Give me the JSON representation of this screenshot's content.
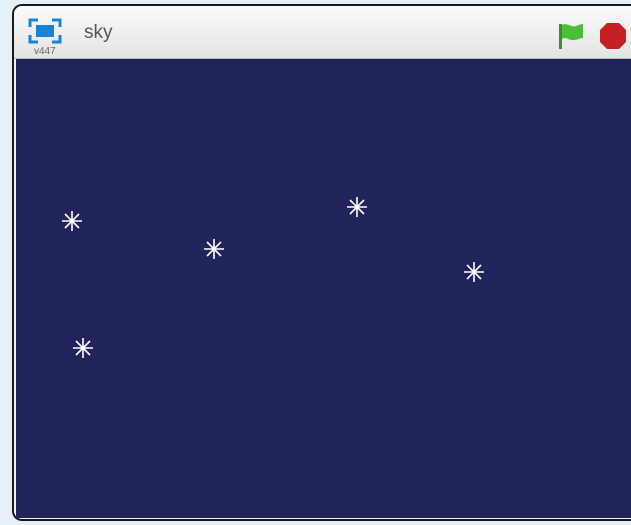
{
  "project": {
    "title": "sky",
    "version": "v447"
  },
  "icons": {
    "fullscreen": "fullscreen-icon",
    "green_flag": "green-flag-icon",
    "stop": "stop-icon",
    "star": "star-sprite"
  },
  "colors": {
    "stage_background": "#21235b",
    "star": "#ffffff",
    "flag": "#4cbf3a",
    "stop": "#c62026",
    "fullscreen": "#1a83d6"
  }
}
